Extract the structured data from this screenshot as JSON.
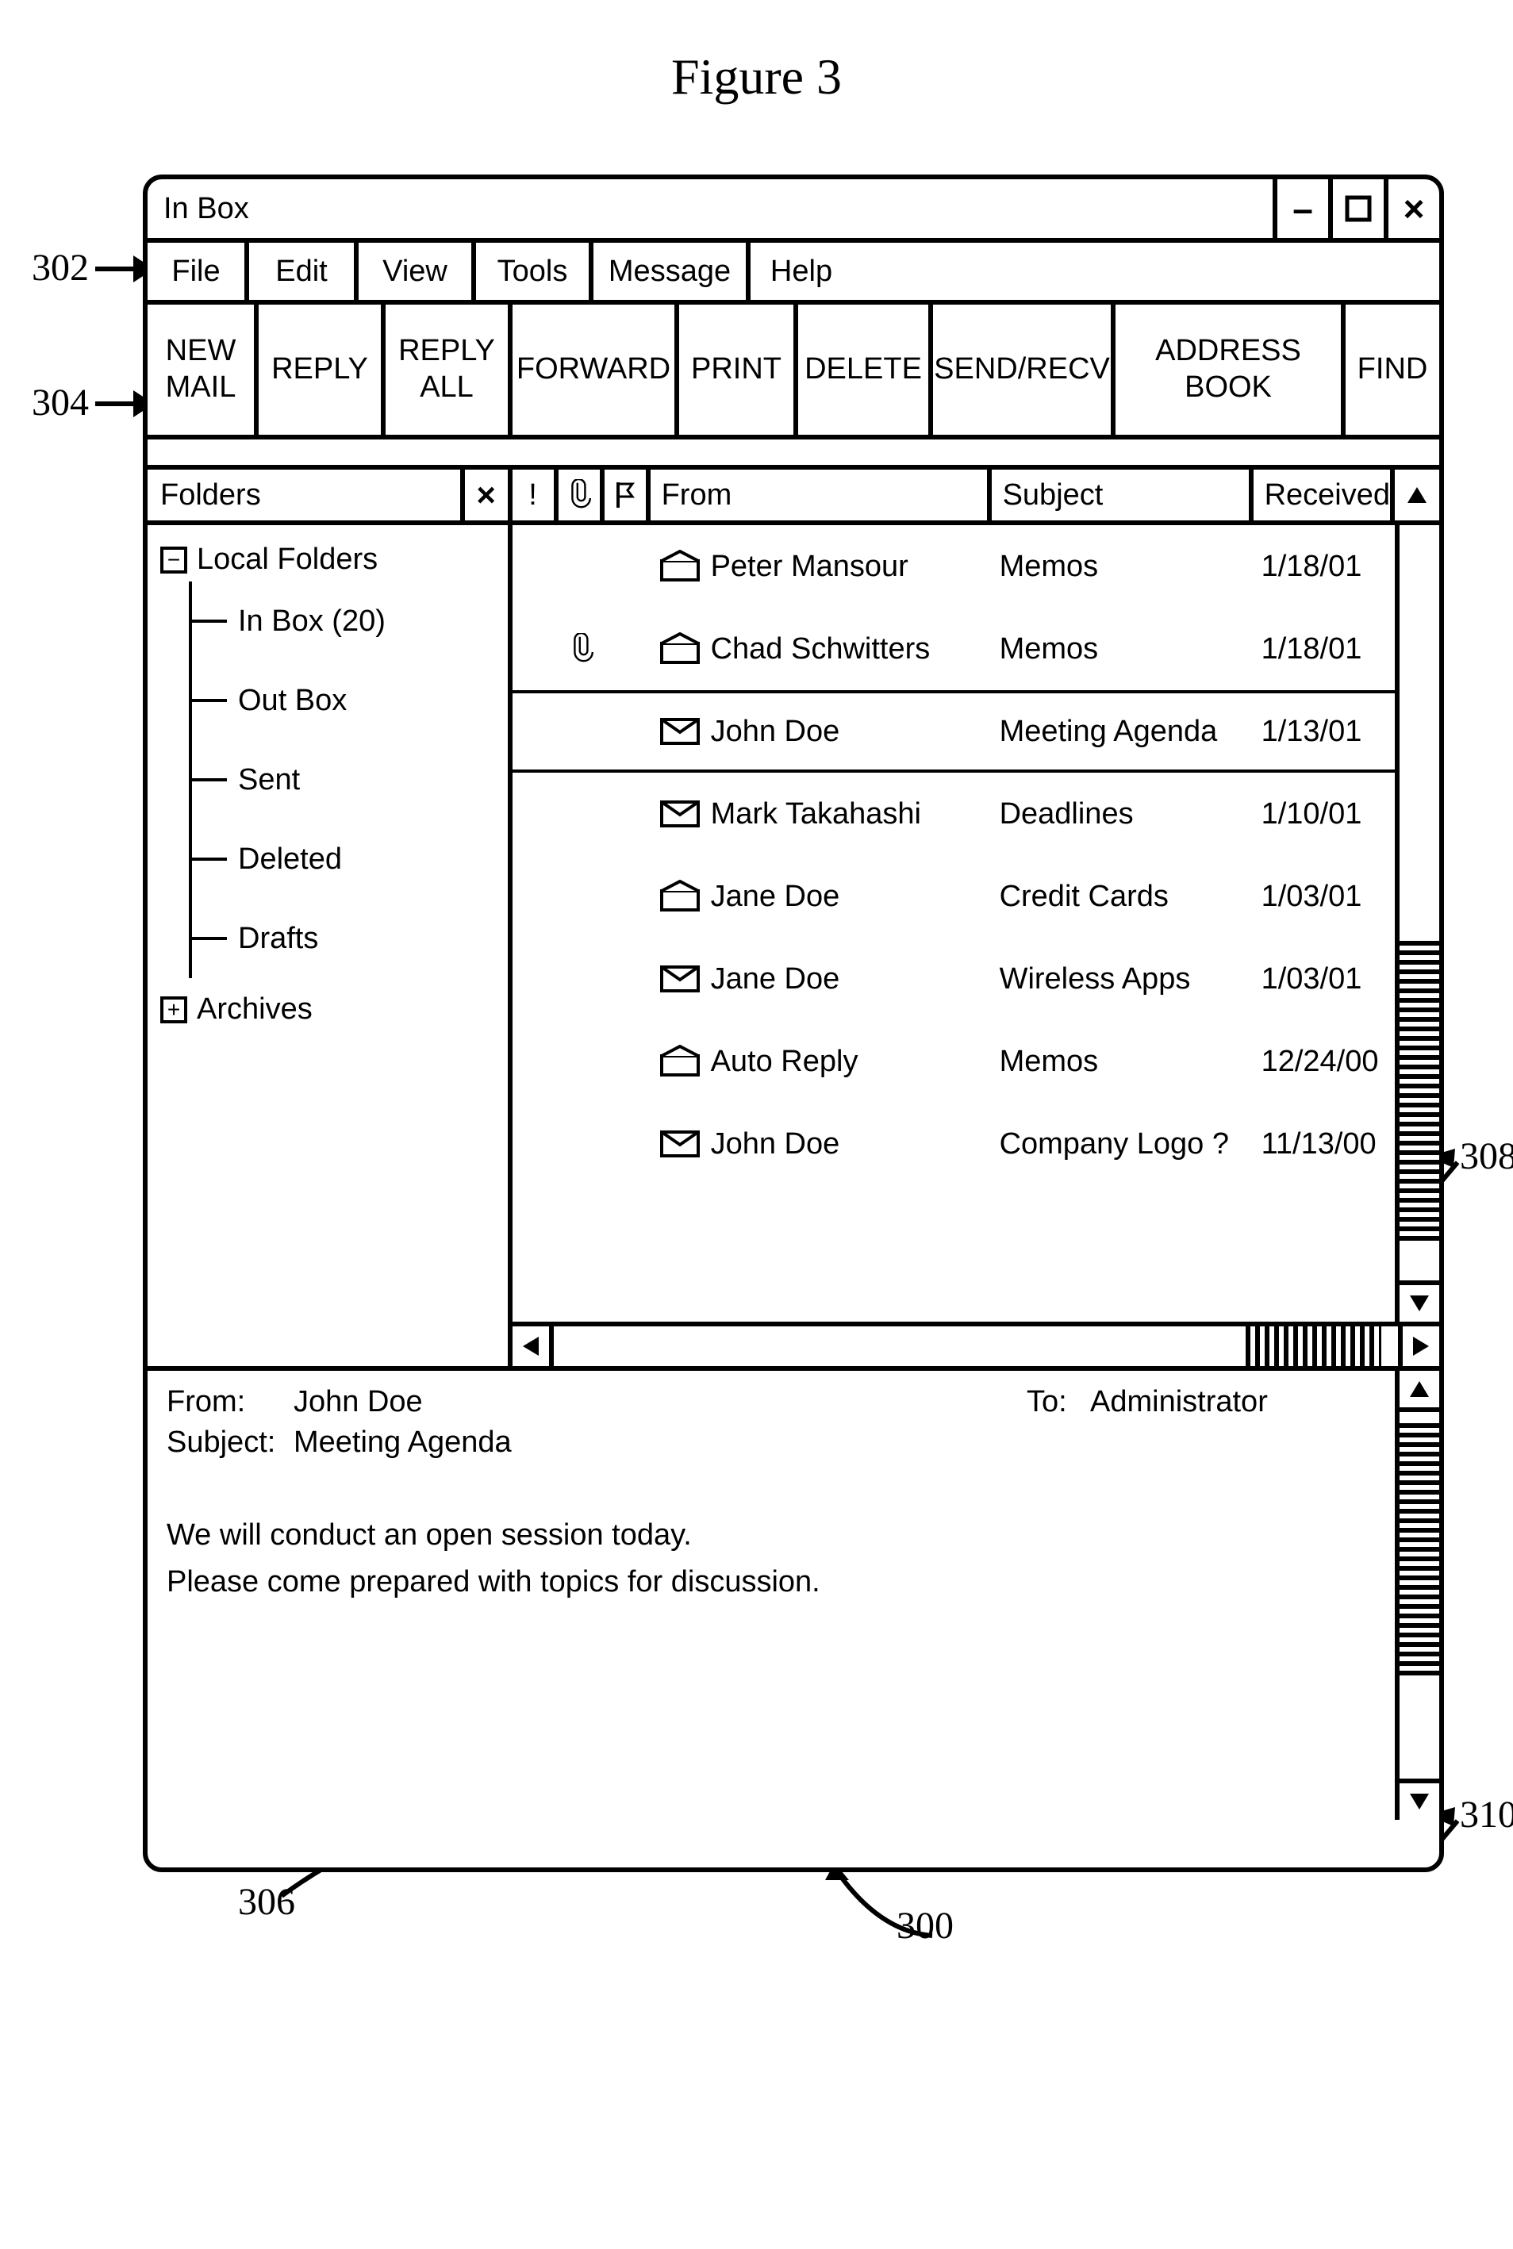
{
  "figure_title": "Figure 3",
  "callouts": {
    "c302": "302",
    "c304": "304",
    "c306": "306",
    "c308": "308",
    "c310": "310",
    "c300": "300"
  },
  "window": {
    "title": "In Box",
    "controls": {
      "min": "–",
      "max": "□",
      "close": "×"
    }
  },
  "menu": [
    "File",
    "Edit",
    "View",
    "Tools",
    "Message",
    "Help"
  ],
  "toolbar": [
    "NEW\nMAIL",
    "REPLY",
    "REPLY\nALL",
    "FORWARD",
    "PRINT",
    "DELETE",
    "SEND/RECV",
    "ADDRESS BOOK",
    "FIND"
  ],
  "folders": {
    "header": "Folders",
    "root": "Local Folders",
    "children": [
      "In Box (20)",
      "Out Box",
      "Sent",
      "Deleted",
      "Drafts"
    ],
    "plus_symbol": "+",
    "minus_symbol": "−",
    "archives": "Archives"
  },
  "columns": {
    "bang": "!",
    "clip": "clip",
    "flag": "flag",
    "from": "From",
    "subject": "Subject",
    "received": "Received"
  },
  "messages": [
    {
      "clip": false,
      "open": true,
      "from": "Peter Mansour",
      "subject": "Memos",
      "received": "1/18/01",
      "selected": false
    },
    {
      "clip": true,
      "open": true,
      "from": "Chad Schwitters",
      "subject": "Memos",
      "received": "1/18/01",
      "selected": false
    },
    {
      "clip": false,
      "open": false,
      "from": "John Doe",
      "subject": "Meeting Agenda",
      "received": "1/13/01",
      "selected": true
    },
    {
      "clip": false,
      "open": false,
      "from": "Mark Takahashi",
      "subject": "Deadlines",
      "received": "1/10/01",
      "selected": false
    },
    {
      "clip": false,
      "open": true,
      "from": "Jane Doe",
      "subject": "Credit Cards",
      "received": "1/03/01",
      "selected": false
    },
    {
      "clip": false,
      "open": false,
      "from": "Jane Doe",
      "subject": "Wireless Apps",
      "received": "1/03/01",
      "selected": false
    },
    {
      "clip": false,
      "open": true,
      "from": "Auto Reply",
      "subject": "Memos",
      "received": "12/24/00",
      "selected": false
    },
    {
      "clip": false,
      "open": false,
      "from": "John Doe",
      "subject": "Company Logo ?",
      "received": "11/13/00",
      "selected": false
    }
  ],
  "preview": {
    "from_label": "From:",
    "from": "John Doe",
    "to_label": "To:",
    "to": "Administrator",
    "subject_label": "Subject:",
    "subject": "Meeting Agenda",
    "body_line1": "We will conduct an open session today.",
    "body_line2": "Please come prepared with topics for discussion."
  }
}
